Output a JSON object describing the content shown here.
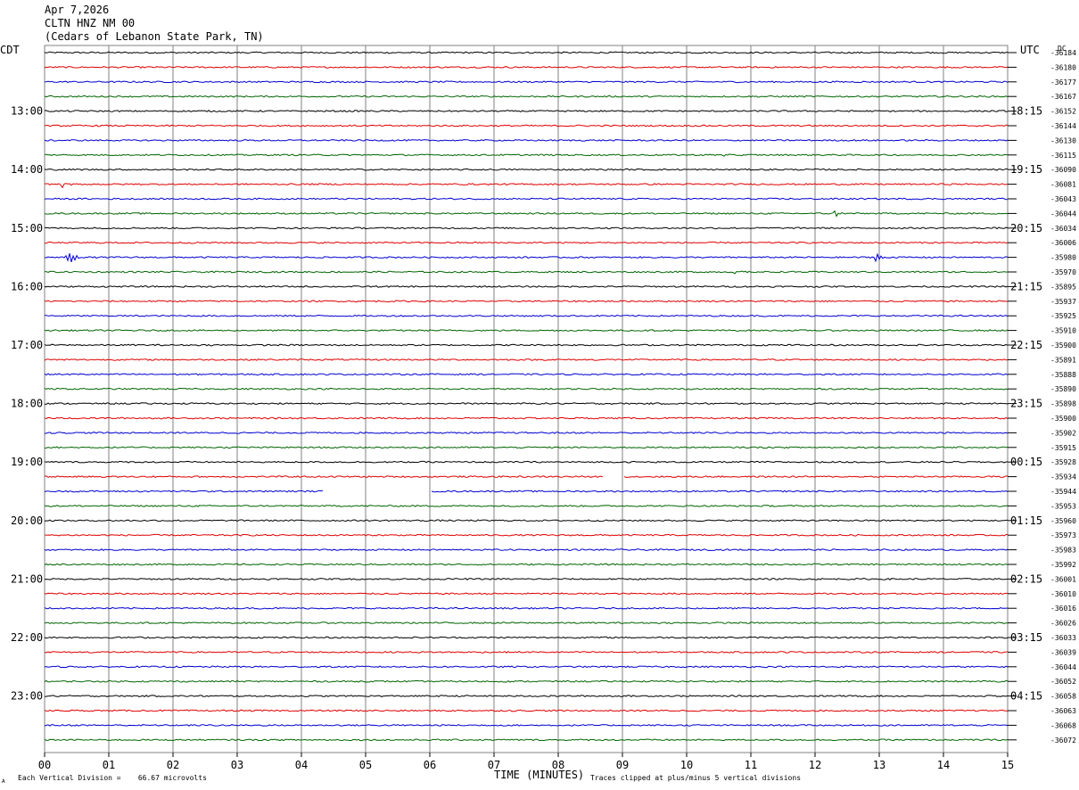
{
  "header": {
    "date": "Apr 7,2026",
    "station": "CLTN HNZ NM 00",
    "location": "(Cedars of Lebanon State Park, TN)"
  },
  "left_tz": "CDT",
  "right_tz": "UTC",
  "dc_label": "DC",
  "footer": {
    "vertical_division": "Each Vertical Division =    66.67 microvolts",
    "clip_note": "Traces clipped at plus/minus 5 vertical divisions",
    "corner_mark": "A"
  },
  "colors": {
    "black": "#000000",
    "red": "#e00000",
    "blue": "#0000d0",
    "green": "#006400",
    "grid": "#808080"
  },
  "chart_data": {
    "type": "line",
    "title": "CLTN HNZ NM 00",
    "xlabel": "TIME (MINUTES)",
    "ylabel": "",
    "xlim": [
      0,
      15
    ],
    "x_ticks": [
      "00",
      "01",
      "02",
      "03",
      "04",
      "05",
      "06",
      "07",
      "08",
      "09",
      "10",
      "11",
      "12",
      "13",
      "14",
      "15"
    ],
    "trace_colors": [
      "black",
      "red",
      "blue",
      "green"
    ],
    "left_hour_labels": [
      "13:00",
      "14:00",
      "15:00",
      "16:00",
      "17:00",
      "18:00",
      "19:00",
      "20:00",
      "21:00",
      "22:00",
      "23:00"
    ],
    "right_hour_labels": [
      "18:15",
      "19:15",
      "20:15",
      "21:15",
      "22:15",
      "23:15",
      "00:15",
      "01:15",
      "02:15",
      "03:15",
      "04:15"
    ],
    "dc_offsets": [
      "-36184",
      "-36180",
      "-36177",
      "-36167",
      "-36152",
      "-36144",
      "-36130",
      "-36115",
      "-36090",
      "-36081",
      "-36043",
      "-36044",
      "-36034",
      "-36006",
      "-35980",
      "-35970",
      "-35895",
      "-35937",
      "-35925",
      "-35910",
      "-35900",
      "-35891",
      "-35888",
      "-35890",
      "-35898",
      "-35900",
      "-35902",
      "-35915",
      "-35928",
      "-35934",
      "-35944",
      "-35953",
      "-35960",
      "-35973",
      "-35983",
      "-35992",
      "-36001",
      "-36010",
      "-36016",
      "-36026",
      "-36033",
      "-36039",
      "-36044",
      "-36052",
      "-36058",
      "-36063",
      "-36068",
      "-36072"
    ],
    "events": [
      {
        "trace": 7,
        "minute": 10.6,
        "amplitude": 0.2
      },
      {
        "trace": 9,
        "minute": 0.28,
        "amplitude": 0.6
      },
      {
        "trace": 11,
        "minute": 12.3,
        "amplitude": 0.5
      },
      {
        "trace": 14,
        "minute": 0.35,
        "amplitude": 1.8
      },
      {
        "trace": 14,
        "minute": 12.95,
        "amplitude": 0.5
      },
      {
        "trace": 15,
        "minute": 10.75,
        "amplitude": 0.4
      }
    ],
    "gaps": [
      {
        "trace": 29,
        "start": 8.7,
        "end": 9.0
      },
      {
        "trace": 30,
        "start": 4.35,
        "end": 6.0
      }
    ]
  }
}
